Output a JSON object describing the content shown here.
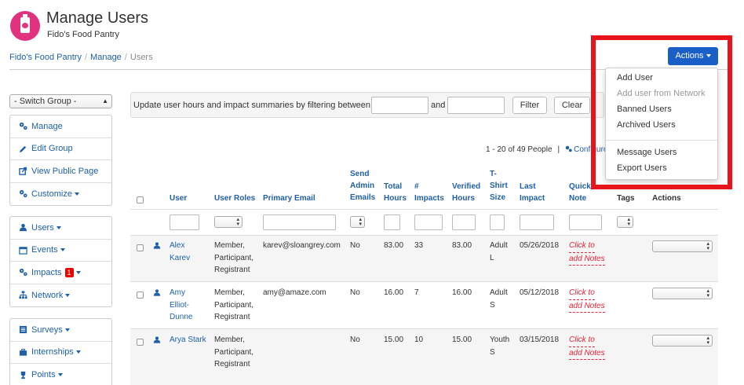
{
  "header": {
    "title": "Manage Users",
    "subtitle": "Fido's Food Pantry"
  },
  "breadcrumb": {
    "items": [
      "Fido's Food Pantry",
      "Manage"
    ],
    "current": "Users"
  },
  "actions": {
    "label": "Actions",
    "menu": [
      {
        "label": "Add User",
        "disabled": false
      },
      {
        "label": "Add user from Network",
        "disabled": true
      },
      {
        "label": "Banned Users",
        "disabled": false
      },
      {
        "label": "Archived Users",
        "disabled": false
      },
      {
        "label": "Message Users",
        "disabled": false
      },
      {
        "label": "Export Users",
        "disabled": false
      }
    ]
  },
  "sidebar": {
    "switch_group": "- Switch Group -",
    "group1": [
      "Manage",
      "Edit Group",
      "View Public Page",
      "Customize"
    ],
    "group2": [
      "Users",
      "Events",
      "Impacts",
      "Network"
    ],
    "impacts_badge": "1",
    "group3": [
      "Surveys",
      "Internships",
      "Points"
    ]
  },
  "filter": {
    "text": "Update user hours and impact summaries by filtering between",
    "and": "and",
    "filter_btn": "Filter",
    "clear_btn": "Clear"
  },
  "pager": {
    "range": "1 - 20 of 49 People",
    "separator": "|",
    "configure": "Configure"
  },
  "table": {
    "headers": {
      "user": "User",
      "roles": "User Roles",
      "email": "Primary Email",
      "send1": "Send",
      "send2": "Admin",
      "send3": "Emails",
      "total1": "Total",
      "total2": "Hours",
      "imp1": "#",
      "imp2": "Impacts",
      "ver1": "Verified",
      "ver2": "Hours",
      "shirt1": "T-",
      "shirt2": "Shirt",
      "shirt3": "Size",
      "last1": "Last",
      "last2": "Impact",
      "quick1": "Quick",
      "quick2": "Note",
      "tags": "Tags",
      "actions": "Actions"
    },
    "rows": [
      {
        "name1": "Alex",
        "name2": "Karev",
        "roles": [
          "Member,",
          "Participant,",
          "Registrant"
        ],
        "email": "karev@sloangrey.com",
        "send": "No",
        "total": "83.00",
        "impacts": "33",
        "verified": "83.00",
        "shirt1": "Adult",
        "shirt2": "L",
        "last": "05/26/2018",
        "note1": "Click to",
        "note2": "add Notes"
      },
      {
        "name1": "Amy",
        "name2": "Elliot-",
        "name3": "Dunne",
        "roles": [
          "Member,",
          "Participant,",
          "Registrant"
        ],
        "email": "amy@amaze.com",
        "send": "No",
        "total": "16.00",
        "impacts": "7",
        "verified": "16.00",
        "shirt1": "Adult",
        "shirt2": "S",
        "last": "05/12/2018",
        "note1": "Click to",
        "note2": "add Notes"
      },
      {
        "name1": "Arya Stark",
        "roles": [
          "Member,",
          "Participant,",
          "Registrant"
        ],
        "email": "",
        "send": "No",
        "total": "15.00",
        "impacts": "10",
        "verified": "15.00",
        "shirt1": "Youth",
        "shirt2": "S",
        "last": "03/15/2018",
        "note1": "Click to",
        "note2": "add Notes"
      }
    ]
  },
  "colors": {
    "primary": "#1a5fc8",
    "link": "#1f5fa8",
    "highlight": "#e8141c",
    "note": "#e0263a",
    "brand": "#e0327f"
  }
}
